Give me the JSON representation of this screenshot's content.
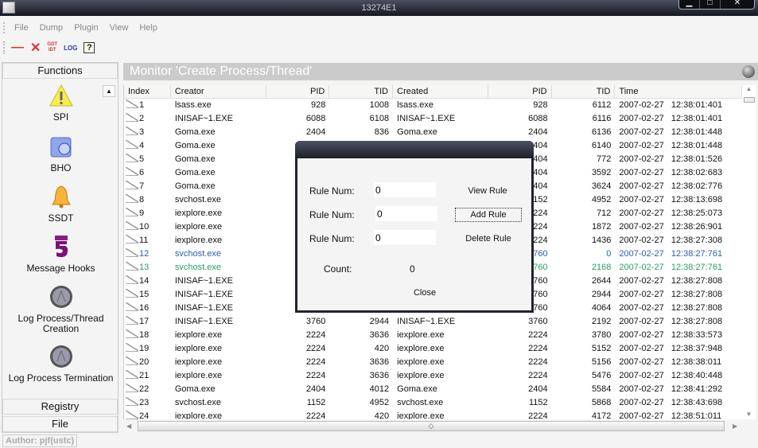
{
  "window": {
    "title": "13274E1",
    "controls": [
      "minimize",
      "maximize",
      "close"
    ]
  },
  "menu": [
    "File",
    "Dump",
    "Plugin",
    "View",
    "Help"
  ],
  "toolbar": {
    "gdt_label": "GDT",
    "idt_label": "IDT",
    "log_label": "LOG",
    "help_label": "?"
  },
  "sidebar": {
    "header": "Functions",
    "items": [
      {
        "label": "SPI",
        "icon": "warning-icon"
      },
      {
        "label": "BHO",
        "icon": "folder-globe-icon"
      },
      {
        "label": "SSDT",
        "icon": "bell-icon"
      },
      {
        "label": "Message Hooks",
        "icon": "hook-icon"
      },
      {
        "label": "Log Process/Thread Creation",
        "icon": "orb-icon"
      },
      {
        "label": "Log Process Termination",
        "icon": "orb-icon"
      }
    ],
    "sections": [
      "Registry",
      "File"
    ]
  },
  "main": {
    "title": "Monitor 'Create Process/Thread'",
    "columns": [
      "Index",
      "Creator",
      "PID",
      "TID",
      "Created",
      "PID",
      "TID",
      "Time"
    ],
    "rows": [
      [
        "1",
        "lsass.exe",
        "928",
        "1008",
        "lsass.exe",
        "928",
        "6112",
        "2007-02-27   12:38:01:401"
      ],
      [
        "2",
        "INISAF~1.EXE",
        "6088",
        "6108",
        "INISAF~1.EXE",
        "6088",
        "6116",
        "2007-02-27   12:38:01:401"
      ],
      [
        "3",
        "Goma.exe",
        "2404",
        "836",
        "Goma.exe",
        "2404",
        "6136",
        "2007-02-27   12:38:01:448"
      ],
      [
        "4",
        "Goma.exe",
        "",
        "",
        "",
        "2404",
        "6140",
        "2007-02-27   12:38:01:448"
      ],
      [
        "5",
        "Goma.exe",
        "",
        "",
        "",
        "2404",
        "772",
        "2007-02-27   12:38:01:526"
      ],
      [
        "6",
        "Goma.exe",
        "",
        "",
        "",
        "2404",
        "3592",
        "2007-02-27   12:38:02:683"
      ],
      [
        "7",
        "Goma.exe",
        "",
        "",
        "",
        "2404",
        "3624",
        "2007-02-27   12:38:02:776"
      ],
      [
        "8",
        "svchost.exe",
        "",
        "",
        "",
        "1152",
        "4952",
        "2007-02-27   12:38:13:698"
      ],
      [
        "9",
        "iexplore.exe",
        "",
        "",
        "",
        "2224",
        "712",
        "2007-02-27   12:38:25:073"
      ],
      [
        "10",
        "iexplore.exe",
        "",
        "",
        "",
        "2224",
        "1872",
        "2007-02-27   12:38:26:901"
      ],
      [
        "11",
        "iexplore.exe",
        "",
        "",
        "",
        "2224",
        "1436",
        "2007-02-27   12:38:27:308"
      ],
      [
        "12",
        "svchost.exe",
        "",
        "",
        "",
        "3760",
        "0",
        "2007-02-27   12:38:27:761"
      ],
      [
        "13",
        "svchost.exe",
        "",
        "",
        "",
        "3760",
        "2168",
        "2007-02-27   12:38:27:761"
      ],
      [
        "14",
        "INISAF~1.EXE",
        "",
        "",
        "",
        "3760",
        "2644",
        "2007-02-27   12:38:27:808"
      ],
      [
        "15",
        "INISAF~1.EXE",
        "",
        "",
        "",
        "3760",
        "2944",
        "2007-02-27   12:38:27:808"
      ],
      [
        "16",
        "INISAF~1.EXE",
        "",
        "",
        "",
        "3760",
        "4064",
        "2007-02-27   12:38:27:808"
      ],
      [
        "17",
        "INISAF~1.EXE",
        "3760",
        "2944",
        "INISAF~1.EXE",
        "3760",
        "2192",
        "2007-02-27   12:38:27:808"
      ],
      [
        "18",
        "iexplore.exe",
        "2224",
        "3636",
        "iexplore.exe",
        "2224",
        "3780",
        "2007-02-27   12:38:33:573"
      ],
      [
        "19",
        "iexplore.exe",
        "2224",
        "420",
        "iexplore.exe",
        "2224",
        "5152",
        "2007-02-27   12:38:37:948"
      ],
      [
        "20",
        "iexplore.exe",
        "2224",
        "3636",
        "iexplore.exe",
        "2224",
        "5156",
        "2007-02-27   12:38:38:011"
      ],
      [
        "21",
        "iexplore.exe",
        "2224",
        "3636",
        "iexplore.exe",
        "2224",
        "5476",
        "2007-02-27   12:38:40:448"
      ],
      [
        "22",
        "Goma.exe",
        "2404",
        "4012",
        "Goma.exe",
        "2404",
        "5584",
        "2007-02-27   12:38:41:292"
      ],
      [
        "23",
        "svchost.exe",
        "1152",
        "4952",
        "svchost.exe",
        "1152",
        "5868",
        "2007-02-27   12:38:43:698"
      ],
      [
        "24",
        "iexplore.exe",
        "2224",
        "420",
        "iexplore.exe",
        "2224",
        "4172",
        "2007-02-27   12:38:51:011"
      ]
    ],
    "row_colors": {
      "12": "#2a5db0",
      "13": "#2aa068"
    }
  },
  "dialog": {
    "rule_label": "Rule Num:",
    "rule_values": [
      "0",
      "0",
      "0"
    ],
    "view_rule": "View Rule",
    "add_rule": "Add Rule",
    "delete_rule": "Delete Rule",
    "count_label": "Count:",
    "count_value": "0",
    "close": "Close"
  },
  "status": {
    "author": "Author: pjf(ustc)"
  }
}
